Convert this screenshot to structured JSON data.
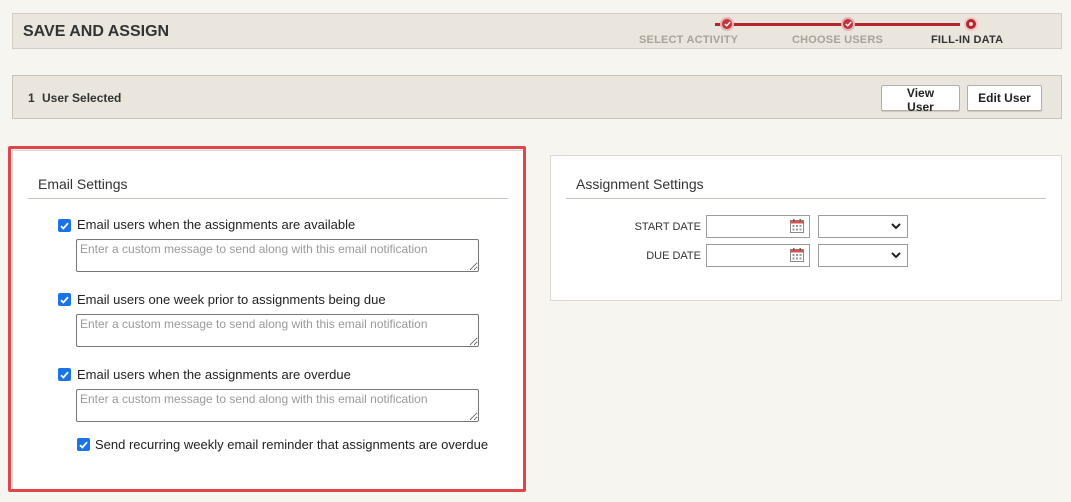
{
  "header": {
    "title": "SAVE AND ASSIGN",
    "steps": [
      {
        "label": "SELECT ACTIVITY",
        "state": "complete"
      },
      {
        "label": "CHOOSE USERS",
        "state": "complete"
      },
      {
        "label": "FILL-IN DATA",
        "state": "current"
      }
    ],
    "step_color": "#b3262e"
  },
  "selection": {
    "count": "1",
    "text": "User Selected",
    "view_label": "View User",
    "edit_label": "Edit User"
  },
  "email_settings": {
    "title": "Email Settings",
    "options": [
      {
        "label": "Email users when the assignments are available",
        "checked": true,
        "placeholder": "Enter a custom message to send along with this email notification"
      },
      {
        "label": "Email users one week prior to assignments being due",
        "checked": true,
        "placeholder": "Enter a custom message to send along with this email notification"
      },
      {
        "label": "Email users when the assignments are overdue",
        "checked": true,
        "placeholder": "Enter a custom message to send along with this email notification"
      }
    ],
    "recurring": {
      "label": "Send recurring weekly email reminder that assignments are overdue",
      "checked": true
    }
  },
  "assignment_settings": {
    "title": "Assignment Settings",
    "start_label": "START DATE",
    "due_label": "DUE DATE",
    "start_value": "",
    "due_value": "",
    "start_time": "",
    "due_time": ""
  },
  "colors": {
    "highlight": "#e0454b",
    "checkbox": "#1a73e8",
    "bar_bg": "#eae6dd"
  }
}
